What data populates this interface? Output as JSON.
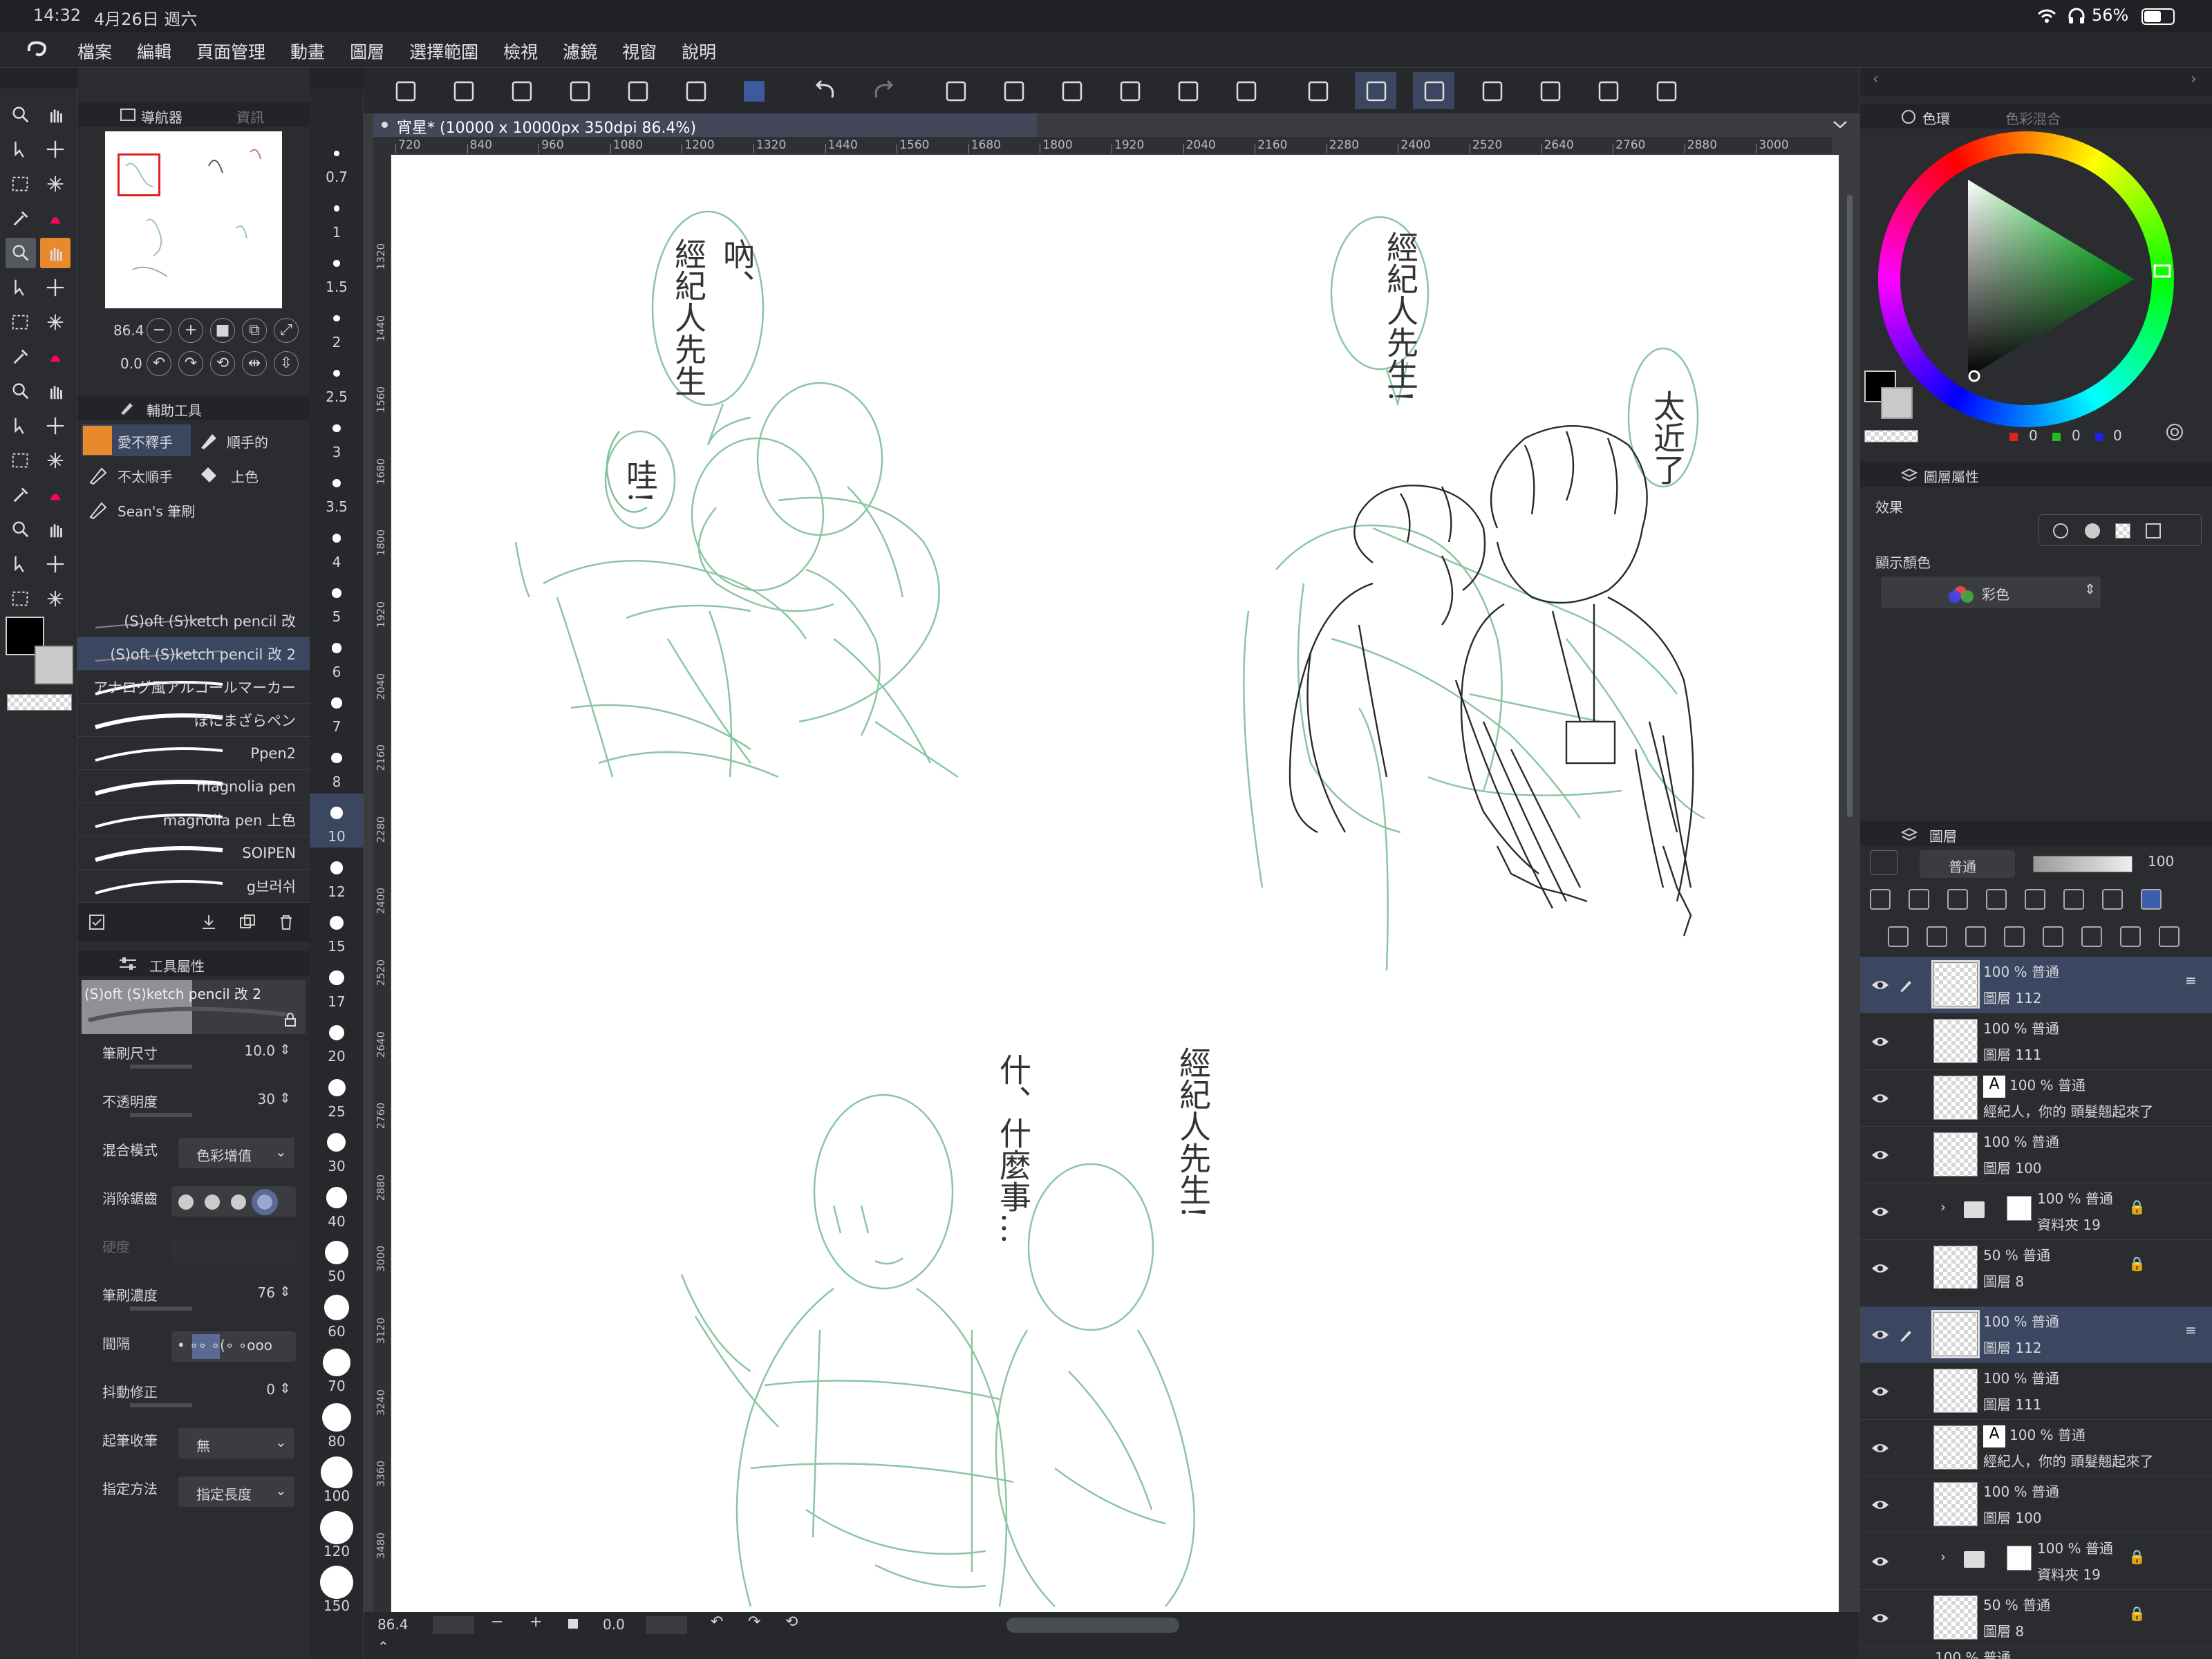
{
  "status": {
    "time": "14:32",
    "date": "4月26日 週六",
    "battery": "56%"
  },
  "menu": [
    "檔案",
    "編輯",
    "頁面管理",
    "動畫",
    "圖層",
    "選擇範圍",
    "檢視",
    "濾鏡",
    "視窗",
    "說明"
  ],
  "navigator": {
    "tab1": "導航器",
    "tab2": "資訊",
    "zoom": "86.4",
    "rotation": "0.0"
  },
  "sub_tool": {
    "title": "輔助工具",
    "groups": [
      "愛不釋手",
      "順手的",
      "不太順手",
      "上色",
      "Sean's 筆刷"
    ],
    "brushes": [
      "(S)oft (S)ketch pencil 改",
      "(S)oft (S)ketch pencil 改 2",
      "アナログ風アルコールマーカー",
      "ぼにまざらペン",
      "Ppen2",
      "magnolia pen",
      "magnolia pen 上色",
      "SOIPEN",
      "g브러쉬"
    ]
  },
  "tool_property": {
    "title": "工具屬性",
    "brush_name": "(S)oft (S)ketch pencil 改 2",
    "brush_size_label": "筆刷尺寸",
    "brush_size": "10.0",
    "opacity_label": "不透明度",
    "opacity": "30",
    "blend_label": "混合模式",
    "blend": "色彩增值",
    "aa_label": "消除鋸齒",
    "hardness_label": "硬度",
    "density_label": "筆刷濃度",
    "density": "76",
    "interval_label": "間隔",
    "stabilizer_label": "抖動修正",
    "stabilizer": "0",
    "taper_label": "起筆收筆",
    "taper": "無",
    "method_label": "指定方法",
    "method": "指定長度"
  },
  "brush_sizes": [
    "0.7",
    "1",
    "1.5",
    "2",
    "2.5",
    "3",
    "3.5",
    "4",
    "5",
    "6",
    "7",
    "8",
    "10",
    "12",
    "15",
    "17",
    "20",
    "25",
    "30",
    "40",
    "50",
    "60",
    "70",
    "80",
    "100",
    "120",
    "150"
  ],
  "canvas": {
    "tab_title": "宵星* (10000 x 10000px 350dpi 86.4%)",
    "ruler_top": [
      "720",
      "840",
      "960",
      "1080",
      "1200",
      "1320",
      "1440",
      "1560",
      "1680",
      "1800",
      "1920",
      "2040",
      "2160",
      "2280",
      "2400",
      "2520",
      "2640",
      "2760",
      "2880",
      "3000"
    ],
    "ruler_left": [
      "1320",
      "1440",
      "1560",
      "1680",
      "1800",
      "1920",
      "2040",
      "2160",
      "2280",
      "2400",
      "2520",
      "2640",
      "2760",
      "2880",
      "3000",
      "3120",
      "3240",
      "3360",
      "3480"
    ],
    "bottom_zoom": "86.4",
    "bottom_rot": "0.0",
    "sketch_text": {
      "b1": "經紀人先生",
      "b1b": "吶、",
      "b2": "哇!",
      "b3": "經紀人先生!",
      "b4": "太近了",
      "b5": "什、什麼事…",
      "b6": "經紀人先生!"
    }
  },
  "color": {
    "tab1": "色環",
    "tab2": "色彩混合",
    "r": "0",
    "g": "0",
    "b": "0"
  },
  "layer_property": {
    "tabs": [
      "圖層屬性"
    ],
    "effect_label": "效果",
    "display_color_label": "顯示顏色",
    "display_color": "彩色"
  },
  "layers_panel": {
    "title": "圖層",
    "blend": "普通",
    "opacity": "100",
    "layers": [
      {
        "pct": "100 %",
        "mode": "普通",
        "name": "圖層 112",
        "selected": true,
        "type": "raster"
      },
      {
        "pct": "100 %",
        "mode": "普通",
        "name": "圖層 111",
        "selected": false,
        "type": "raster"
      },
      {
        "pct": "100 %",
        "mode": "普通",
        "name": "經紀人，你的 頭髮翹起來了",
        "selected": false,
        "type": "text"
      },
      {
        "pct": "100 %",
        "mode": "普通",
        "name": "圖層 100",
        "selected": false,
        "type": "raster"
      },
      {
        "pct": "100 %",
        "mode": "普通",
        "name": "資料夾 19",
        "selected": false,
        "type": "folder"
      },
      {
        "pct": "50 %",
        "mode": "普通",
        "name": "圖層 8",
        "selected": false,
        "type": "raster"
      },
      {
        "pct": "100 %",
        "mode": "普通",
        "name": "",
        "selected": false,
        "type": "partial"
      }
    ],
    "layers2": [
      {
        "pct": "100 %",
        "mode": "普通",
        "name": "圖層 112",
        "selected": true,
        "type": "raster"
      },
      {
        "pct": "100 %",
        "mode": "普通",
        "name": "圖層 111",
        "selected": false,
        "type": "raster"
      },
      {
        "pct": "100 %",
        "mode": "普通",
        "name": "經紀人，你的 頭髮翹起來了",
        "selected": false,
        "type": "text"
      },
      {
        "pct": "100 %",
        "mode": "普通",
        "name": "圖層 100",
        "selected": false,
        "type": "raster"
      },
      {
        "pct": "100 %",
        "mode": "普通",
        "name": "資料夾 19",
        "selected": false,
        "type": "folder"
      },
      {
        "pct": "50 %",
        "mode": "普通",
        "name": "圖層 8",
        "selected": false,
        "type": "raster"
      },
      {
        "pct": "100 %",
        "mode": "普通",
        "name": "",
        "selected": false,
        "type": "partial"
      }
    ]
  },
  "colors": {
    "accent": "#3b4660",
    "orange": "#e8892b",
    "sketch_green": "#7fbf98",
    "sketch_dark": "#2a2a2a"
  }
}
